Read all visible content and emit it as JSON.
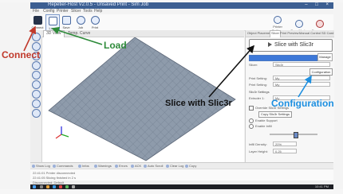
{
  "window": {
    "title": "Repetier-Host V2.0.5 - Unsaved Print - Sim Job",
    "controls": "– □ ×"
  },
  "menu": [
    "File",
    "Config",
    "Printer",
    "Slicer",
    "Tools",
    "Help"
  ],
  "toolbar": {
    "connect_label": "Connect",
    "load_label": "Load",
    "save_label": "Save",
    "job_label": "Job",
    "print_label": "Print",
    "right_tools": [
      {
        "label": "Printer Settings",
        "icon": "gear-icon"
      },
      {
        "label": "Easy Mode",
        "icon": "easy-mode-icon"
      },
      {
        "label": "Emergency",
        "icon": "emergency-icon"
      }
    ]
  },
  "view_tabs": [
    "3D View",
    "Temp. Curve"
  ],
  "panel": {
    "tabs": [
      "Object Placement",
      "Slicer",
      "Print Preview",
      "Manual Control",
      "SD Card"
    ],
    "slice_button": "Slice with Slic3r",
    "progress_percent": 100,
    "view_button": "Manage",
    "rows": [
      {
        "label": "Slicer:",
        "value": "Slic3r"
      },
      {
        "label": "Print Setting:",
        "value": "My"
      },
      {
        "label": "Print Setting:",
        "value": "My"
      },
      {
        "label": "Extruder 1:",
        "value": "My"
      }
    ],
    "config_button": "Configuration",
    "section_title": "Slic3r Settings",
    "checkbox_override": "Override Slic3r Settings",
    "copy_button": "Copy Slic3r Settings",
    "radio_enable": "Enable Support",
    "radio_fill": "Enable Infill",
    "infill_label": "Infill Density:",
    "infill_value": "20%",
    "layer_label": "Layer Height:",
    "layer_value": "0.25"
  },
  "bottom_tabs": [
    {
      "label": "Show Log",
      "checked": true
    },
    {
      "label": "Commands"
    },
    {
      "label": "Infos"
    },
    {
      "label": "Warnings"
    },
    {
      "label": "Errors"
    },
    {
      "label": "ACK"
    },
    {
      "label": "Auto Scroll"
    },
    {
      "label": "Clear Log"
    },
    {
      "label": "Copy"
    }
  ],
  "log_lines": [
    "22:41:01  Printer disconnected",
    "22:41:05  Slicing finished in 2 s"
  ],
  "status": "Disconnected: Default",
  "taskbar": {
    "clock": "10:41 PM"
  },
  "annotations": {
    "connect": "Connect",
    "load": "Load",
    "slice": "Slice with Slic3r",
    "config": "Configuration"
  },
  "colors": {
    "annotation_connect": "#c0392b",
    "annotation_load": "#2e8b3a",
    "annotation_config": "#1d8fe0",
    "bed_grid": "#7f8fa3",
    "titlebar": "#3c5f92"
  }
}
